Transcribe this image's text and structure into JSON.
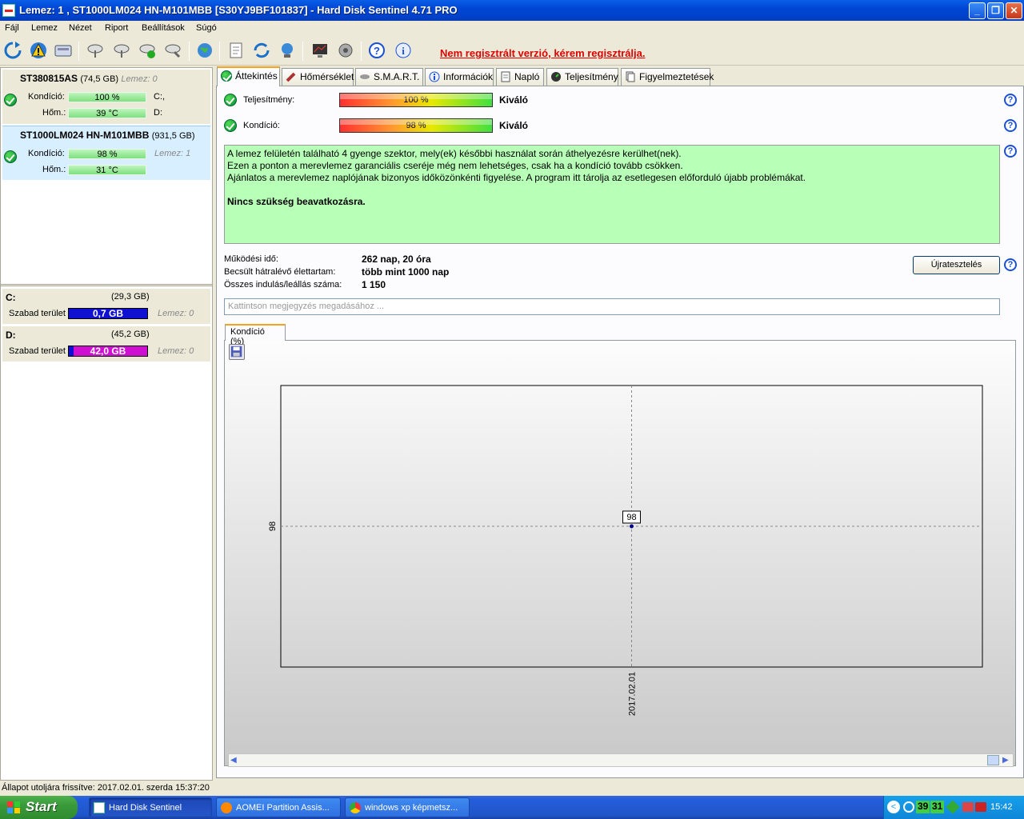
{
  "window": {
    "title": "Lemez: 1 , ST1000LM024 HN-M101MBB [S30YJ9BF101837]  -  Hard Disk Sentinel 4.71 PRO"
  },
  "menu": [
    "Fájl",
    "Lemez",
    "Nézet",
    "Riport",
    "Beállítások",
    "Súgó"
  ],
  "toolbar": {
    "registration_warning": "Nem regisztrált verzió, kérem regisztrálja."
  },
  "disks": [
    {
      "name": "ST380815AS",
      "size": "(74,5 GB)",
      "lemez": "Lemez: 0",
      "kondicio_label": "Kondíció:",
      "kondicio": "100 %",
      "hom_label": "Hőm.:",
      "hom": "39 °C",
      "drive1": "C:,",
      "drive2": "D:"
    },
    {
      "name": "ST1000LM024 HN-M101MBB",
      "size": "(931,5 GB)",
      "lemez": "Lemez: 1",
      "kondicio_label": "Kondíció:",
      "kondicio": "98 %",
      "hom_label": "Hőm.:",
      "hom": "31 °C"
    }
  ],
  "drives": [
    {
      "letter": "C:",
      "size": "(29,3 GB)",
      "free_label": "Szabad terület",
      "free": "0,7 GB",
      "lemez": "Lemez: 0",
      "color": "#1010d0"
    },
    {
      "letter": "D:",
      "size": "(45,2 GB)",
      "free_label": "Szabad terület",
      "free": "42,0 GB",
      "lemez": "Lemez: 0",
      "color": "#d010d0"
    }
  ],
  "tabs": [
    "Áttekintés",
    "Hőmérséklet",
    "S.M.A.R.T.",
    "Információk",
    "Napló",
    "Teljesítmény",
    "Figyelmeztetések"
  ],
  "overview": {
    "perf_label": "Teljesítmény:",
    "perf_value": "100 %",
    "perf_rating": "Kiváló",
    "cond_label": "Kondíció:",
    "cond_value": "98 %",
    "cond_rating": "Kiváló",
    "message_lines": [
      "A lemez felületén található 4 gyenge szektor, mely(ek) későbbi használat során áthelyezésre kerülhet(nek).",
      "Ezen a ponton a merevlemez garanciális cseréje még nem lehetséges, csak ha a kondíció tovább csökken.",
      "Ajánlatos a merevlemez naplójának bizonyos időközönkénti figyelése. A program itt tárolja az esetlegesen előforduló újabb problémákat."
    ],
    "message_bold": "Nincs szükség beavatkozásra.",
    "uptime_label": "Működési idő:",
    "uptime": "262 nap, 20 óra",
    "lifetime_label": "Becsült hátralévő élettartam:",
    "lifetime": "több mint 1000 nap",
    "starts_label": "Összes indulás/leállás száma:",
    "starts": "1 150",
    "retest_button": "Újratesztelés",
    "note_placeholder": "Kattintson megjegyzés megadásához ..."
  },
  "chart_tab": "Kondíció  (%)",
  "chart_data": {
    "type": "line",
    "x": [
      "2017.02.01"
    ],
    "series": [
      {
        "values": [
          98
        ]
      }
    ],
    "ylabel": "",
    "xlabel": "",
    "ytick": "98",
    "point_label": "98",
    "grid": true
  },
  "status": "Állapot utoljára frissítve: 2017.02.01. szerda 15:37:20",
  "taskbar": {
    "start": "Start",
    "tasks": [
      "Hard Disk Sentinel",
      "AOMEI Partition Assis...",
      "windows xp képmetsz..."
    ],
    "tray_nums": [
      "39",
      "31"
    ],
    "clock": "15:42"
  }
}
